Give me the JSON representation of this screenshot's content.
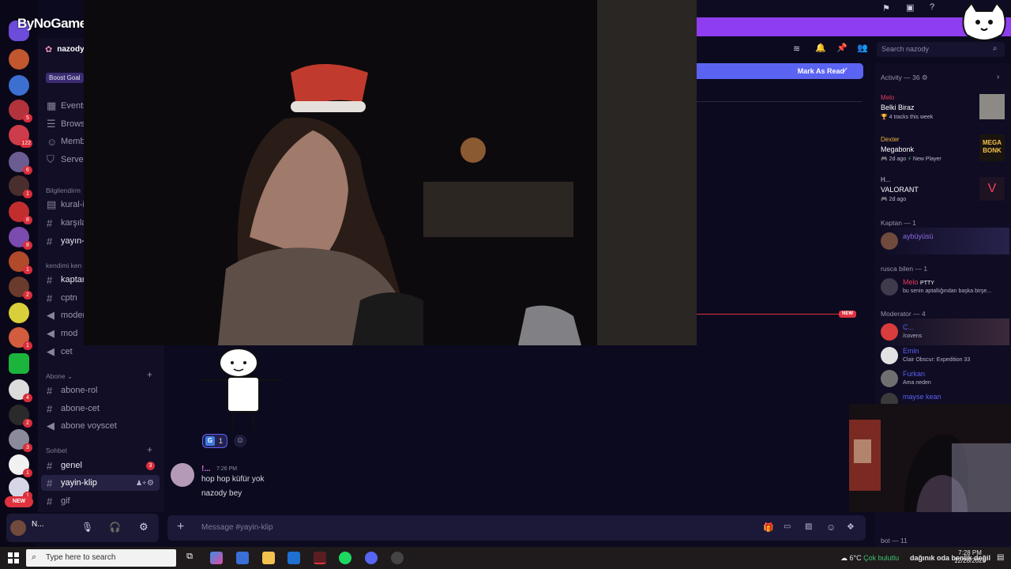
{
  "watermark": "ByNoGame",
  "server": {
    "name": "nazody",
    "boost": "Boost Goal"
  },
  "sidebar": {
    "nav": [
      "Events",
      "Brows",
      "Memb",
      "Server"
    ],
    "categories": [
      {
        "label": "Bilgilendirm",
        "channels": [
          "kural-i",
          "karşıla",
          "yayın-"
        ]
      },
      {
        "label": "kendimi ken",
        "channels": [
          "kaptan",
          "cptn",
          "moder",
          "mod",
          "cet"
        ]
      },
      {
        "label": "Abone",
        "channels": [
          "abone-rol",
          "abone-cet",
          "abone voyscet"
        ]
      },
      {
        "label": "Sohbet",
        "channels": [
          "genel",
          "yayin-klip",
          "gif"
        ]
      }
    ],
    "genel_unread": "3"
  },
  "rail": {
    "badges": [
      "5",
      "122",
      "6",
      "1",
      "8",
      "8",
      "1",
      "2",
      "1",
      "4",
      "2",
      "3",
      "1",
      "1"
    ],
    "new_pill": "NEW"
  },
  "header": {
    "search_placeholder": "Search nazody",
    "mark_read": "Mark As Read",
    "new_tag": "NEW"
  },
  "reaction": {
    "count": "1"
  },
  "message": {
    "author": "!...",
    "time": "7:26 PM",
    "lines": [
      "hop hop küfür yok",
      "nazody bey"
    ]
  },
  "composer": {
    "placeholder": "Message #yayin-klip"
  },
  "user_panel": {
    "name": "N..."
  },
  "members": {
    "activity_header": "Activity — 36",
    "activity": [
      {
        "name": "Melo",
        "title": "Belki Biraz",
        "sub": "4 tracks this week"
      },
      {
        "name": "Dexter",
        "title": "Megabonk",
        "sub": "2d ago",
        "sub2": "New Player"
      },
      {
        "name": "H...",
        "title": "VALORANT",
        "sub": "2d ago"
      }
    ],
    "sections": [
      {
        "label": "Kaptan — 1",
        "members": [
          {
            "name": "aybüyüsü",
            "sub": ""
          }
        ]
      },
      {
        "label": "rusca bilen — 1",
        "members": [
          {
            "name": "Melo",
            "tag": "PTTY",
            "sub": "bu senin aptallığından başka birşe..."
          }
        ]
      },
      {
        "label": "Moderator — 4",
        "members": [
          {
            "name": "C...",
            "sub": "/covens"
          },
          {
            "name": "Emin",
            "sub": "Clair Obscur: Expedition 33"
          },
          {
            "name": "Furkan",
            "sub": "Ama neden"
          },
          {
            "name": "mayse kean",
            "sub": ""
          }
        ]
      },
      {
        "label": "bot — 11",
        "members": []
      }
    ],
    "megabonk_art": "MEGA BONK"
  },
  "taskbar": {
    "search_placeholder": "Type here to search",
    "weather": "6°C",
    "weather_text": "Çok bulutlu",
    "ticker": "dağınık oda benlik değil",
    "time": "7:28 PM",
    "date": "12/28/2025"
  },
  "colors": {
    "accent": "#8f3df0",
    "blurple": "#5b63f3",
    "danger": "#e0323f",
    "bg": "#0c0a1f"
  }
}
